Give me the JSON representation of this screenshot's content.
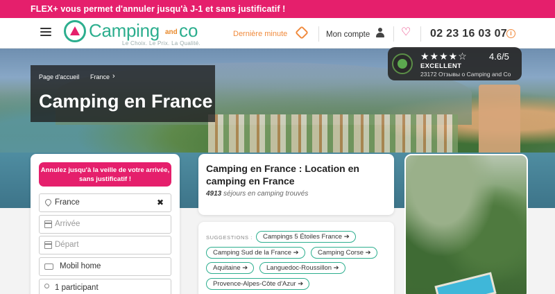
{
  "promo": "FLEX+ vous permet d'annuler jusqu'à J-1 et sans justificatif !",
  "header": {
    "logo_main": "Camping",
    "logo_and": "and",
    "logo_co": "co",
    "logo_tagline": "Le Choix. Le Prix. La Qualité.",
    "last_minute": "Dernière minute",
    "account": "Mon compte",
    "phone": "02 23 16 03 07"
  },
  "breadcrumb": [
    "Page d'accueil",
    "France"
  ],
  "page_title": "Camping en France",
  "trust": {
    "stars": "★★★★☆",
    "rating": "4.6/5",
    "label": "EXCELLENT",
    "reviews": "23172 Отзывы о Camping and Co"
  },
  "search": {
    "flex_banner": "Annulez jusqu'à la veille de votre arrivée, sans justificatif !",
    "destination_value": "France",
    "arrival_placeholder": "Arrivée",
    "departure_placeholder": "Départ",
    "accommodation": "Mobil home",
    "participants": "1 participant"
  },
  "results": {
    "title": "Camping en France : Location en camping en France",
    "count": "4913",
    "count_suffix": "séjours en camping trouvés"
  },
  "suggestions": {
    "label": "SUGGESTIONS :",
    "chips": [
      "Campings 5 Étoiles France ➔",
      "Camping Sud de la France ➔",
      "Camping Corse ➔",
      "Aquitaine ➔",
      "Languedoc-Roussillon ➔",
      "Provence-Alpes-Côte d'Azur ➔"
    ]
  },
  "colors": {
    "brand_pink": "#e51f6c",
    "brand_green": "#2cae8e",
    "accent_orange": "#f08a3c"
  }
}
